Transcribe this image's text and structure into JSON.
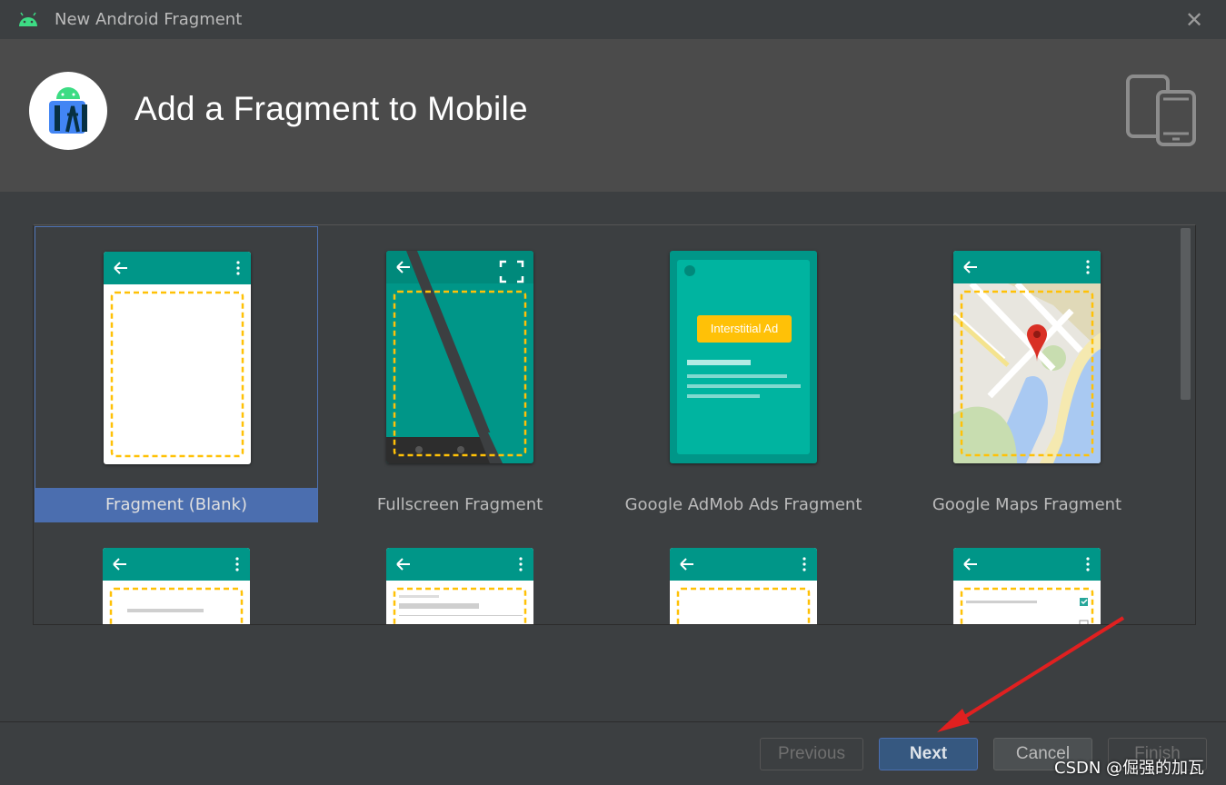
{
  "window": {
    "title": "New Android Fragment",
    "close_glyph": "✕"
  },
  "header": {
    "heading": "Add a Fragment to Mobile"
  },
  "templates": [
    {
      "label": "Fragment (Blank)",
      "selected": true
    },
    {
      "label": "Fullscreen Fragment",
      "selected": false
    },
    {
      "label": "Google AdMob Ads Fragment",
      "selected": false
    },
    {
      "label": "Google Maps Fragment",
      "selected": false
    }
  ],
  "admob_badge": "Interstitial Ad",
  "buttons": {
    "previous": "Previous",
    "next": "Next",
    "cancel": "Cancel",
    "finish": "Finish"
  },
  "watermark": "CSDN @倔强的加瓦",
  "colors": {
    "teal": "#009688",
    "teal_light": "#00b4a0",
    "selection": "#4b6eaf",
    "dashed": "#ffc107",
    "arrow": "#e02020"
  }
}
